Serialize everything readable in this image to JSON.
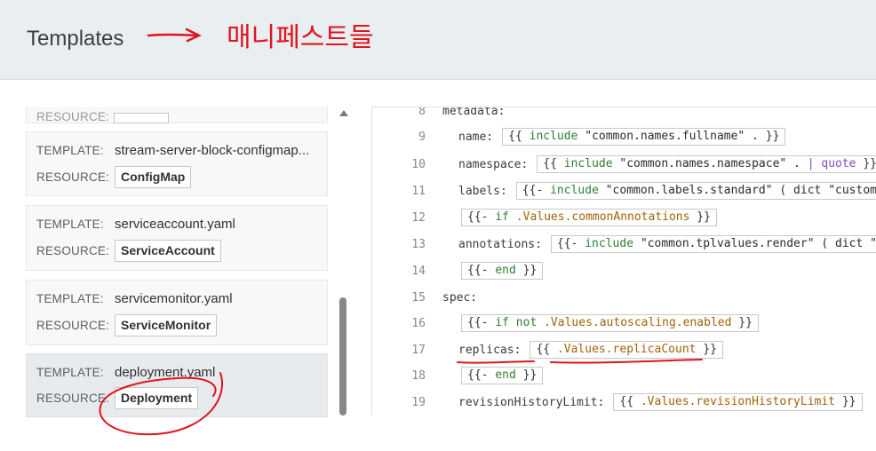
{
  "header": {
    "title": "Templates",
    "annotation_text": "매니페스트들"
  },
  "templates": [
    {
      "template_label": "TEMPLATE:",
      "template_name": "stream-server-block-configmap...",
      "resource_label": "RESOURCE:",
      "resource": "ConfigMap"
    },
    {
      "template_label": "TEMPLATE:",
      "template_name": "serviceaccount.yaml",
      "resource_label": "RESOURCE:",
      "resource": "ServiceAccount"
    },
    {
      "template_label": "TEMPLATE:",
      "template_name": "servicemonitor.yaml",
      "resource_label": "RESOURCE:",
      "resource": "ServiceMonitor"
    },
    {
      "template_label": "TEMPLATE:",
      "template_name": "deployment.yaml",
      "resource_label": "RESOURCE:",
      "resource": "Deployment"
    }
  ],
  "partial_card": {
    "resource_label": "RESOURCE:"
  },
  "code": {
    "lines": [
      {
        "num": "8",
        "key": "metadata:"
      },
      {
        "num": "9",
        "key": "name:",
        "t_open": "{{",
        "t_kw": "include",
        "t_str": "\"common.names.fullname\" .",
        "t_close": "}}"
      },
      {
        "num": "10",
        "key": "namespace:",
        "t_open": "{{",
        "t_kw": "include",
        "t_str": "\"common.names.namespace\" .",
        "t_pipe": "| quote",
        "t_close": "}}"
      },
      {
        "num": "11",
        "key": "labels:",
        "t_open": "{{-",
        "t_kw": "include",
        "t_str": "\"common.labels.standard\" ( dict \"customLa"
      },
      {
        "num": "12",
        "t_open": "{{-",
        "t_kw": "if",
        "t_fld": ".Values.commonAnnotations",
        "t_close": "}}"
      },
      {
        "num": "13",
        "key": "annotations:",
        "t_open": "{{-",
        "t_kw": "include",
        "t_str": "\"common.tplvalues.render\" ( dict \"v"
      },
      {
        "num": "14",
        "t_open": "{{-",
        "t_kw": "end",
        "t_close": "}}"
      },
      {
        "num": "15",
        "key": "spec:"
      },
      {
        "num": "16",
        "t_open": "{{-",
        "t_kw": "if not",
        "t_fld": ".Values.autoscaling.enabled",
        "t_close": "}}"
      },
      {
        "num": "17",
        "key": "replicas:",
        "t_open": "{{",
        "t_fld": ".Values.replicaCount",
        "t_close": "}}"
      },
      {
        "num": "18",
        "t_open": "{{-",
        "t_kw": "end",
        "t_close": "}}"
      },
      {
        "num": "19",
        "key": "revisionHistoryLimit:",
        "t_open": "{{",
        "t_fld": ".Values.revisionHistoryLimit",
        "t_close": "}}"
      }
    ]
  },
  "colors": {
    "header_bg": "#e9eef0",
    "annotation_red": "#e0141e",
    "keyword_green": "#2e7d32",
    "field_orange": "#a16207"
  }
}
